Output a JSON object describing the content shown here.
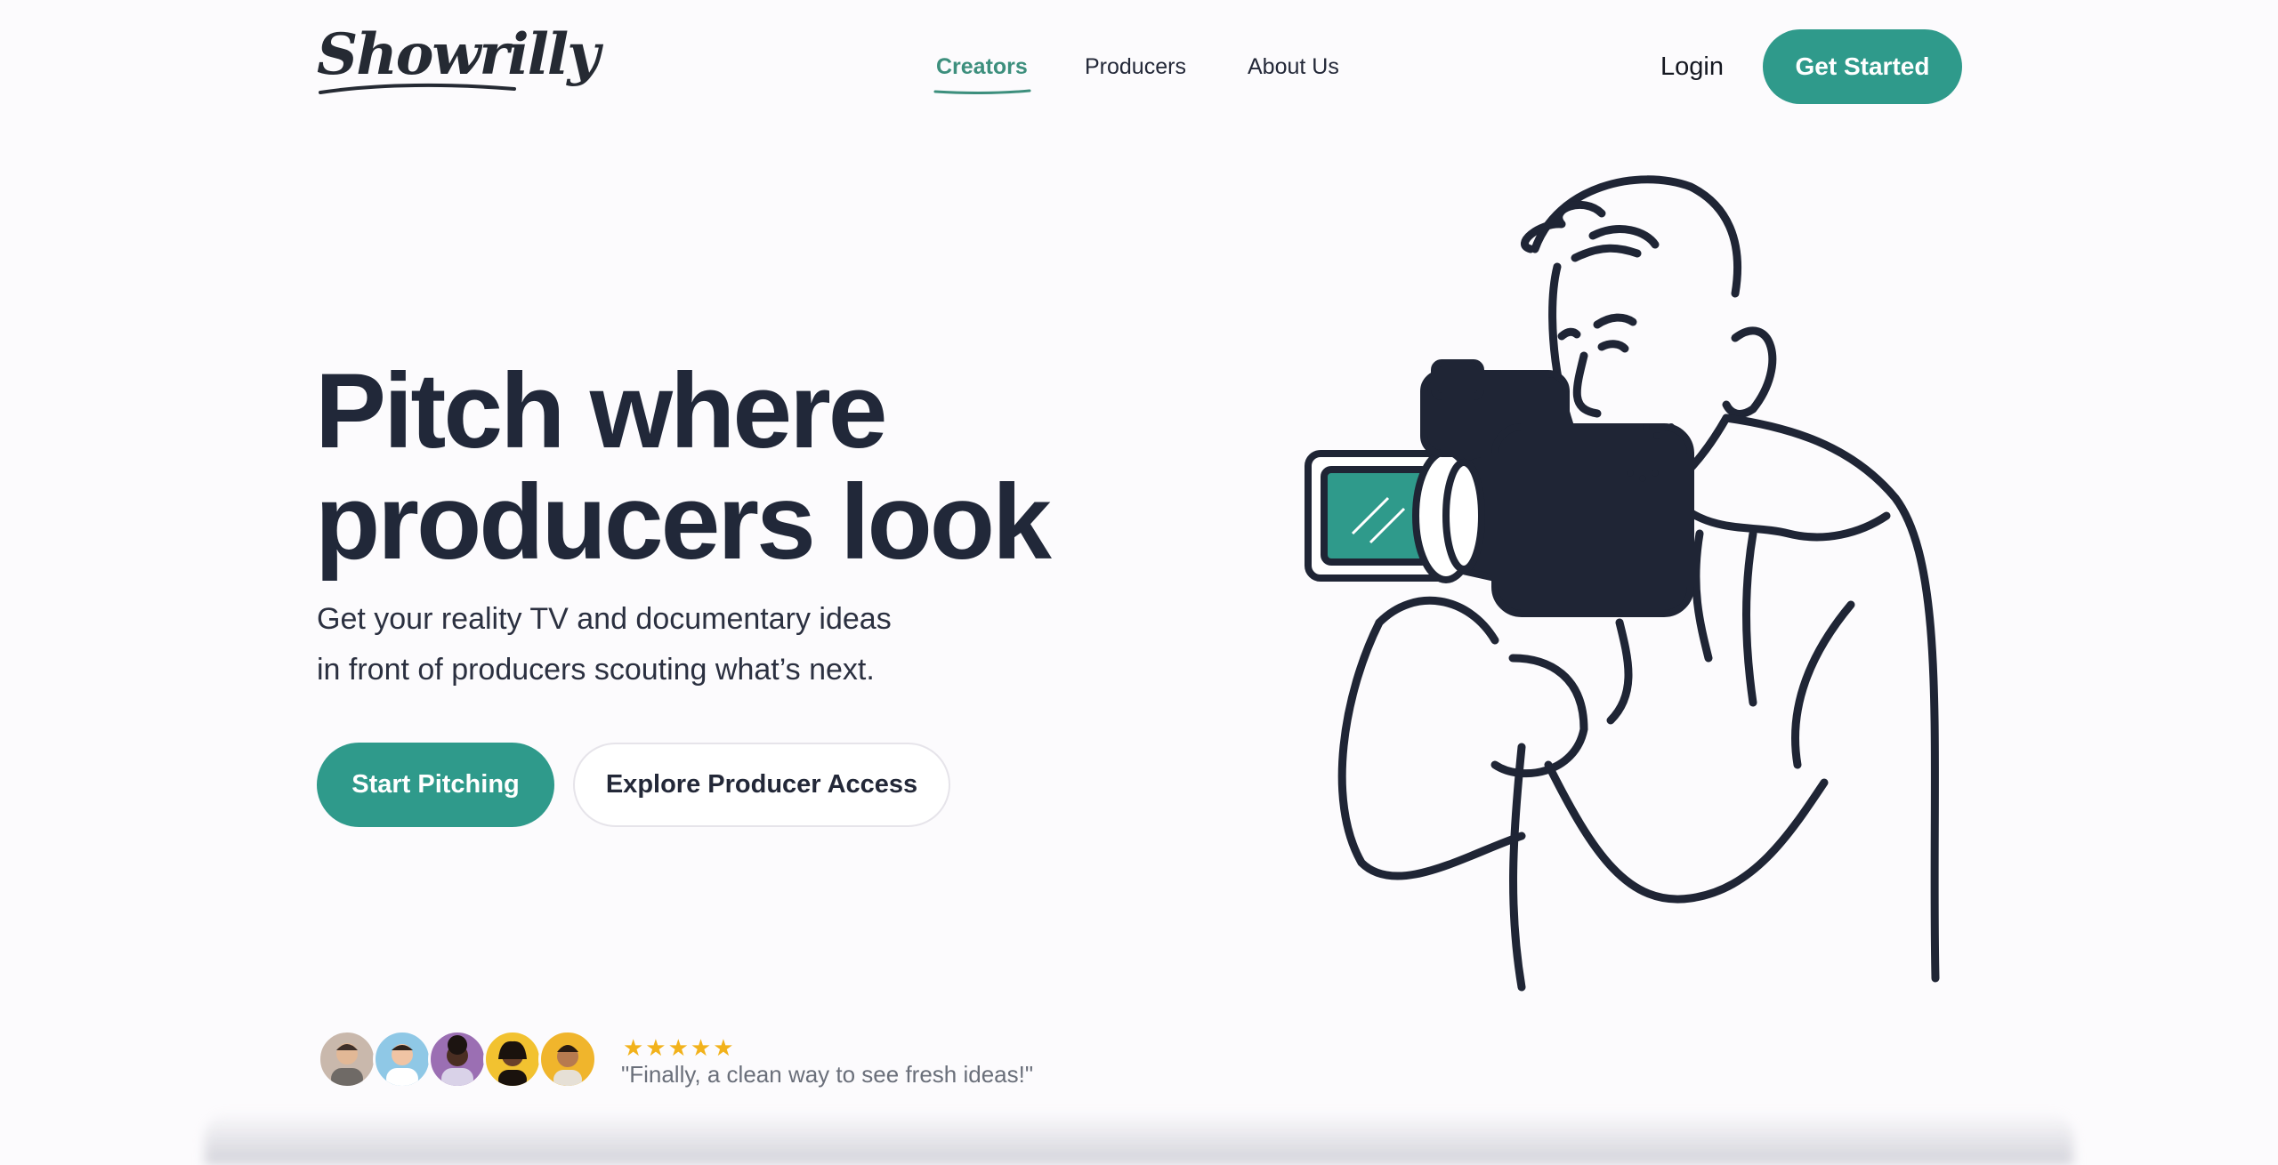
{
  "brand": {
    "logo_text": "Showrilly"
  },
  "nav": {
    "items": [
      {
        "label": "Creators",
        "active": true
      },
      {
        "label": "Producers",
        "active": false
      },
      {
        "label": "About Us",
        "active": false
      }
    ],
    "login_label": "Login",
    "cta_label": "Get Started"
  },
  "hero": {
    "headline_line1": "Pitch where",
    "headline_line2": "producers look",
    "subline_line1": "Get your reality TV and documentary ideas",
    "subline_line2": "in front of producers scouting what’s next.",
    "primary_button": "Start Pitching",
    "secondary_button": "Explore Producer Access"
  },
  "social_proof": {
    "stars": "★★★★★",
    "rating": 5,
    "quote": "\"Finally, a clean way to see fresh ideas!\""
  },
  "colors": {
    "accent": "#2f9a8b",
    "nav_active": "#3d8f7d",
    "ink": "#212839",
    "star": "#f2b21b",
    "background": "#fcfbfd"
  },
  "icons": [
    "logo-swoosh-icon",
    "star-icon",
    "camera-operator-illustration"
  ]
}
